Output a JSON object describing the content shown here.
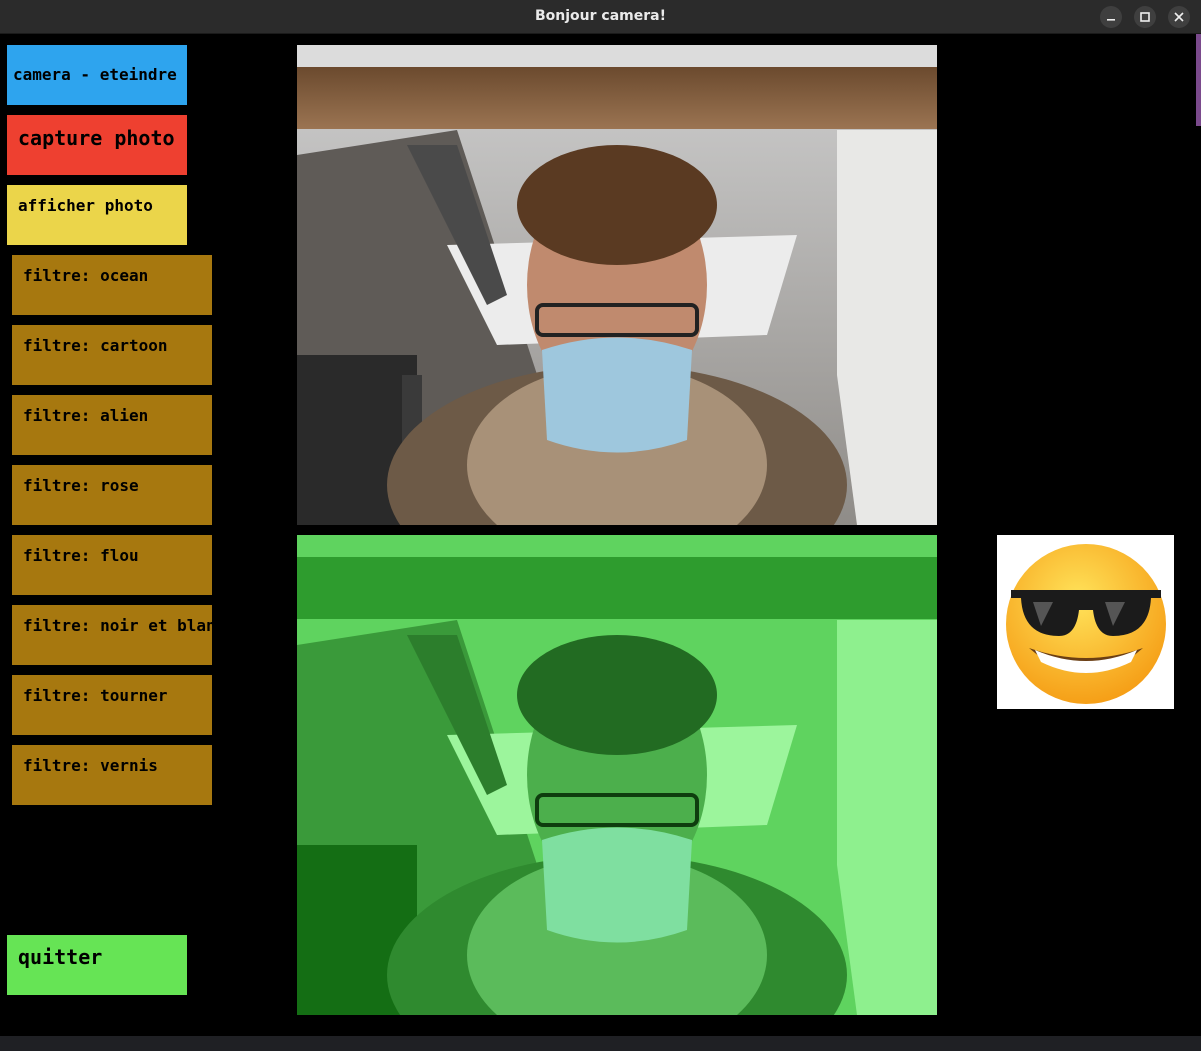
{
  "window": {
    "title": "Bonjour camera!"
  },
  "buttons": {
    "camera": "camera - eteindre",
    "capture": "capture photo",
    "afficher": "afficher photo",
    "quitter": "quitter"
  },
  "filters": [
    "filtre: ocean",
    "filtre: cartoon",
    "filtre: alien",
    "filtre: rose",
    "filtre: flou",
    "filtre: noir et blanc",
    "filtre: tourner",
    "filtre: vernis"
  ],
  "colors": {
    "camera_button": "#2ea4ee",
    "capture_button": "#ee4030",
    "afficher_button": "#ebd54a",
    "filter_button": "#a7780f",
    "quitter_button": "#66e455",
    "filtered_overlay": "#22cc22"
  },
  "icons": [
    "minimize-icon",
    "maximize-icon",
    "close-icon",
    "sunglasses-emoji-icon"
  ]
}
